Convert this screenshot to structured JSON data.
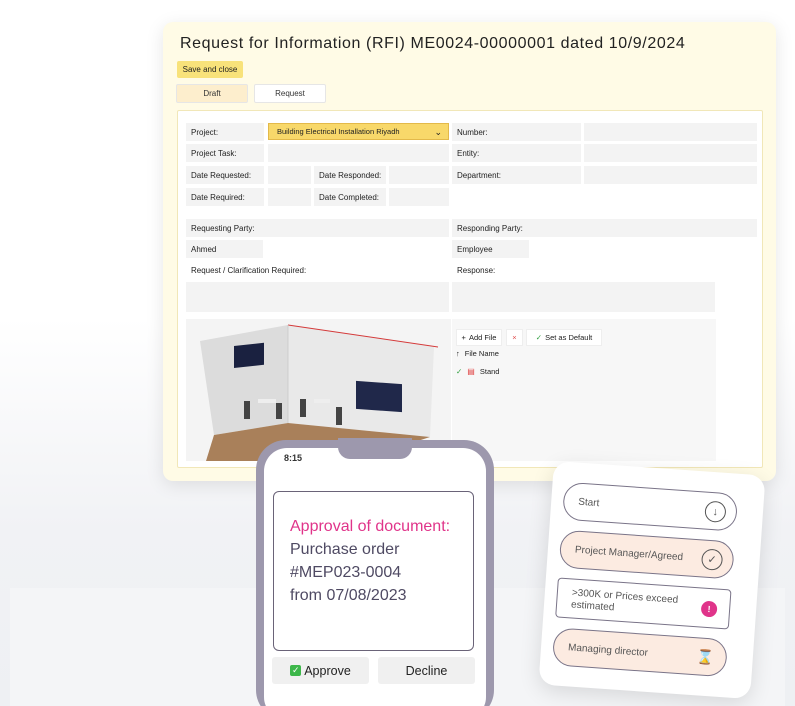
{
  "rfi": {
    "title": "Request for Information (RFI) ME0024-00000001 dated 10/9/2024",
    "save_label": "Save and close",
    "tabs": [
      {
        "label": "Draft"
      },
      {
        "label": "Request"
      }
    ],
    "labels": {
      "project": "Project:",
      "project_task": "Project Task:",
      "date_requested": "Date Requested:",
      "date_responded": "Date Responded:",
      "date_required": "Date Required:",
      "date_completed": "Date Completed:",
      "number": "Number:",
      "entity": "Entity:",
      "department": "Department:",
      "requesting_party": "Requesting Party:",
      "responding_party": "Responding Party:",
      "request_clarification": "Request / Clarification Required:",
      "response": "Response:"
    },
    "values": {
      "project": "Building Electrical Installation Riyadh",
      "requesting_party": "Ahmed",
      "responding_party": "Employee"
    },
    "files": {
      "add_file": "Add File",
      "set_default": "Set as Default",
      "column_header": "File Name",
      "items": [
        {
          "name": "Stand"
        }
      ]
    }
  },
  "phone": {
    "time": "8:15",
    "message": {
      "title": "Approval of document:",
      "line1": "Purchase order",
      "line2": "#MEP023-0004",
      "line3": "from 07/08/2023"
    },
    "approve_label": "Approve",
    "decline_label": "Decline"
  },
  "workflow": {
    "steps": [
      {
        "label": "Start"
      },
      {
        "label": "Project Manager/Agreed"
      },
      {
        "label": ">300K or Prices exceed estimated"
      },
      {
        "label": "Managing director"
      }
    ]
  },
  "colors": {
    "accent_yellow": "#f8d86a",
    "pink": "#e0348a",
    "phone_frame": "#9d98ad",
    "step_fill": "#fcebe1"
  }
}
